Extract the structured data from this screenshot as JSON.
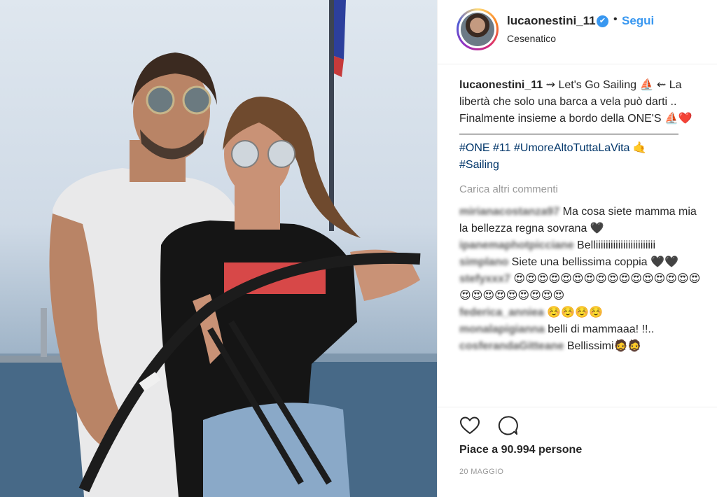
{
  "post": {
    "username": "lucaonestini_11",
    "verified_mark": "✔",
    "separator": "•",
    "follow_label": "Segui",
    "location": "Cesenatico"
  },
  "caption": {
    "username": "lucaonestini_11",
    "text": " ⇝ Let's Go Sailing ⛵ ⇜ La libertà che solo una barca a vela può darti .. Finalmente insieme a bordo della ONE'S ⛵❤️",
    "hashtags_line1": [
      "#ONE",
      "#11",
      "#UmoreAltoTuttaLaVita"
    ],
    "hashtags_line1_emoji": "🤙",
    "hashtags_line2": [
      "#Sailing"
    ]
  },
  "load_more_label": "Carica altri commenti",
  "comments": [
    {
      "user": "mirianacostanza97",
      "text": " Ma cosa siete mamma mia la bellezza regna sovrana 🖤"
    },
    {
      "user": "ipanemaphotpicciane",
      "text": " Belliiiiiiiiiiiiiiiiiiiiiiii"
    },
    {
      "user": "simplano",
      "text": " Siete una bellissima coppia 🖤🖤"
    },
    {
      "user": "stefyxxx7",
      "text": " 😍😍😍😍😍😍😍😍😍😍😍😍😍😍😍😍😍😍😍😍😍😍😍😍😍"
    },
    {
      "user": "federica_anniea",
      "text": " ☺️☺️☺️☺️"
    },
    {
      "user": "monalapigianna",
      "text": " belli di mammaaa! !!.."
    },
    {
      "user": "cosferandaGitteane",
      "text": " Bellissimi🧔🧔"
    }
  ],
  "likes_label": "Piace a 90.994 persone",
  "date_label": "20 MAGGIO",
  "icons": {
    "like": "heart-icon",
    "comment": "comment-icon",
    "verified": "verified-badge-icon"
  },
  "colors": {
    "link_blue": "#3897f0",
    "hashtag": "#003569",
    "muted": "#999999",
    "text": "#262626"
  }
}
